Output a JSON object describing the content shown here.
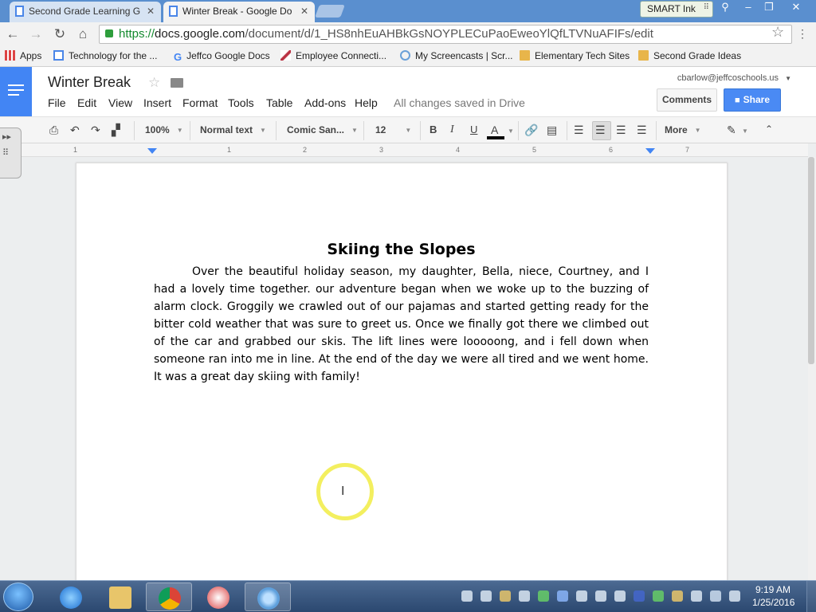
{
  "browser": {
    "tabs": [
      {
        "label": "Second Grade Learning G"
      },
      {
        "label": "Winter Break - Google Do"
      }
    ],
    "smart_ink": "SMART Ink",
    "url": {
      "scheme": "https://",
      "host": "docs.google.com",
      "path": "/document/d/1_HS8nhEuAHBkGsNOYPLECuPaoEweoYlQfLTVNuAFIFs/edit"
    }
  },
  "bookmarks": [
    {
      "label": "Apps",
      "icon": "apps-grid-icon"
    },
    {
      "label": "Technology for the ...",
      "icon": "page-icon"
    },
    {
      "label": "Jeffco Google Docs",
      "icon": "google-icon"
    },
    {
      "label": "Employee Connecti...",
      "icon": "feather-icon"
    },
    {
      "label": "My Screencasts | Scr...",
      "icon": "screencast-icon"
    },
    {
      "label": "Elementary Tech Sites",
      "icon": "folder-icon"
    },
    {
      "label": "Second Grade Ideas",
      "icon": "folder-icon"
    }
  ],
  "docs": {
    "title": "Winter Break",
    "account": "cbarlow@jeffcoschools.us",
    "menu": [
      "File",
      "Edit",
      "View",
      "Insert",
      "Format",
      "Tools",
      "Table",
      "Add-ons",
      "Help"
    ],
    "save_status": "All changes saved in Drive",
    "comments_label": "Comments",
    "share_label": "Share",
    "accent_color": "#4285f4"
  },
  "toolbar": {
    "zoom": "100%",
    "style": "Normal text",
    "font": "Comic San...",
    "font_size": "12",
    "more": "More",
    "bold": "B",
    "italic": "I",
    "underline": "U",
    "text_color": "A"
  },
  "ruler": [
    "1",
    "1",
    "2",
    "3",
    "4",
    "5",
    "6",
    "7"
  ],
  "document": {
    "heading": "Skiing the Slopes",
    "body": "Over the beautiful holiday season, my daughter, Bella, niece, Courtney, and I had a lovely time together. our adventure began when we woke up to the buzzing of alarm clock. Groggily we crawled out of our pajamas and started getting ready for the bitter cold weather that was sure to greet us. Once we finally got there we climbed out of the car and grabbed our skis. The lift lines were looooong, and i fell down when someone ran into me in line. At the end of the day we were all tired and we went home. It was a great day skiing with family!"
  },
  "taskbar": {
    "time": "9:19 AM",
    "date": "1/25/2016"
  }
}
